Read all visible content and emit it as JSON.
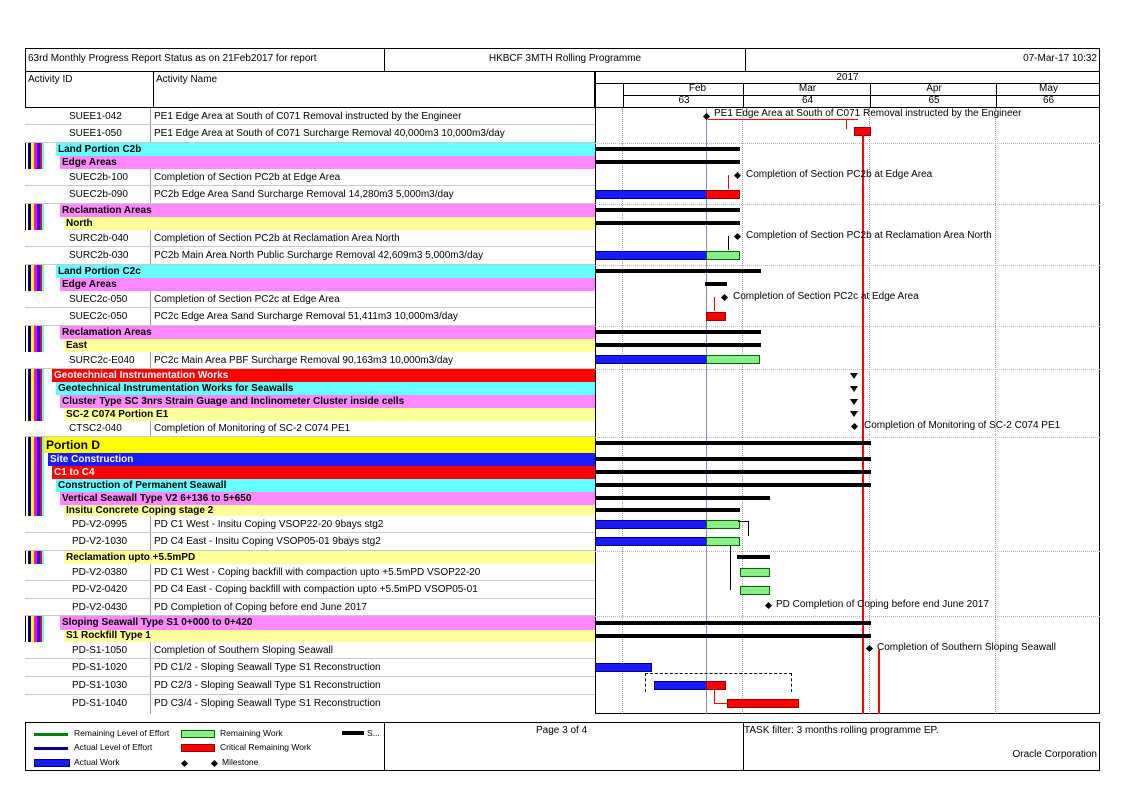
{
  "header": {
    "title": "63rd Monthly Progress Report Status as on 21Feb2017 for report",
    "programme": "HKBCF 3MTH Rolling Programme",
    "date": "07-Mar-17 10:32"
  },
  "columns": {
    "activity_id": "Activity ID",
    "activity_name": "Activity Name"
  },
  "timeline": {
    "year": "2017",
    "months": [
      "Feb",
      "Mar",
      "Apr",
      "May"
    ],
    "weeks": [
      "63",
      "64",
      "65",
      "66"
    ]
  },
  "rows": {
    "r1": {
      "id": "SUEE1-042",
      "name": "PE1 Edge Area at South of C071 Removal instructed by the Engineer"
    },
    "r2": {
      "id": "SUEE1-050",
      "name": "PE1 Edge Area at South of C071 Surcharge Removal 40,000m3 10,000m3/day"
    },
    "b1": "Land Portion C2b",
    "b2": "Edge Areas",
    "r3": {
      "id": "SUEC2b-100",
      "name": "Completion of Section PC2b at Edge Area"
    },
    "r4": {
      "id": "SUEC2b-090",
      "name": "PC2b Edge Area Sand Surcharge Removal 14,280m3 5,000m3/day"
    },
    "b3": "Reclamation Areas",
    "b4": "North",
    "r5": {
      "id": "SURC2b-040",
      "name": "Completion of Section PC2b at Reclamation Area North"
    },
    "r6": {
      "id": "SURC2b-030",
      "name": "PC2b Main Area North Public Surcharge Removal 42,609m3 5,000m3/day"
    },
    "b5": "Land Portion C2c",
    "b6": "Edge Areas",
    "r7": {
      "id": "SUEC2c-050",
      "name": "Completion of Section PC2c at Edge Area"
    },
    "r8": {
      "id": "SUEC2c-050",
      "name": "PC2c Edge Area Sand Surcharge Removal 51,411m3 10,000m3/day"
    },
    "b7": "Reclamation Areas",
    "b8": "East",
    "r9": {
      "id": "SURC2c-E040",
      "name": "PC2c Main Area PBF Surcharge Removal 90,163m3 10,000m3/day"
    },
    "b9": "Geotechnical Instrumentation Works",
    "b10": "Geotechnical Instrumentation Works for Seawalls",
    "b11": "Cluster Type SC 3nrs Strain Guage and Inclinometer Cluster inside cells",
    "b12": "SC-2 C074 Portion E1",
    "r10": {
      "id": "CTSC2-040",
      "name": "Completion of Monitoring of SC-2 C074 PE1"
    },
    "b13": "Portion D",
    "b14": "Site Construction",
    "b15": "C1 to C4",
    "b16": "Construction of Permanent Seawall",
    "b17": "Vertical Seawall Type V2 6+136 to 5+650",
    "b18": "Insitu Concrete Coping stage 2",
    "r11": {
      "id": "PD-V2-0995",
      "name": "PD C1 West - Insitu Coping VSOP22-20 9bays stg2"
    },
    "r12": {
      "id": "PD-V2-1030",
      "name": "PD C4 East - Insitu Coping VSOP05-01 9bays stg2"
    },
    "b19": "Reclamation upto +5.5mPD",
    "r13": {
      "id": "PD-V2-0380",
      "name": "PD C1 West - Coping backfill with compaction upto +5.5mPD VSOP22-20"
    },
    "r14": {
      "id": "PD-V2-0420",
      "name": "PD C4 East - Coping backfill with compaction upto +5.5mPD VSOP05-01"
    },
    "r15": {
      "id": "PD-V2-0430",
      "name": "PD Completion of Coping before end June 2017"
    },
    "b20": "Sloping Seawall Type S1 0+000 to 0+420",
    "b21": "S1 Rockfill Type 1",
    "r16": {
      "id": "PD-S1-1050",
      "name": "Completion of Southern Sloping Seawall"
    },
    "r17": {
      "id": "PD-S1-1020",
      "name": "PD C1/2 - Sloping Seawall Type S1 Reconstruction"
    },
    "r18": {
      "id": "PD-S1-1030",
      "name": "PD C2/3 - Sloping Seawall Type S1 Reconstruction"
    },
    "r19": {
      "id": "PD-S1-1040",
      "name": "PD C3/4 - Sloping Seawall Type S1 Reconstruction"
    }
  },
  "gantt_labels": {
    "g1": "PE1 Edge Area at South of C071 Removal instructed by the Engineer",
    "g2": "Completion of Section PC2b at Edge Area",
    "g3": "Completion of Section PC2b at Reclamation Area North",
    "g4": "Completion of Section PC2c at Edge Area",
    "g5": "Completion of Monitoring of SC-2 C074 PE1",
    "g6": "PD Completion of Coping before end June 2017",
    "g7": "Completion of Southern Sloping Seawall"
  },
  "footer": {
    "legend": {
      "l1": "Remaining Level of Effort",
      "l2": "Actual Level of Effort",
      "l3": "Actual Work",
      "l4": "Remaining Work",
      "l5": "Critical Remaining Work",
      "l6": "Milestone",
      "l7": "S..."
    },
    "page": "Page 3 of 4",
    "filter": "TASK filter: 3 months rolling programme EP.",
    "company": "Oracle Corporation"
  },
  "colors": {
    "cyan": "#66ffff",
    "magenta": "#ff88ff",
    "yellow": "#ffff99",
    "red": "#ff0000",
    "blue": "#1a1aff",
    "green": "#88ee88",
    "brightyellow": "#ffff00"
  }
}
